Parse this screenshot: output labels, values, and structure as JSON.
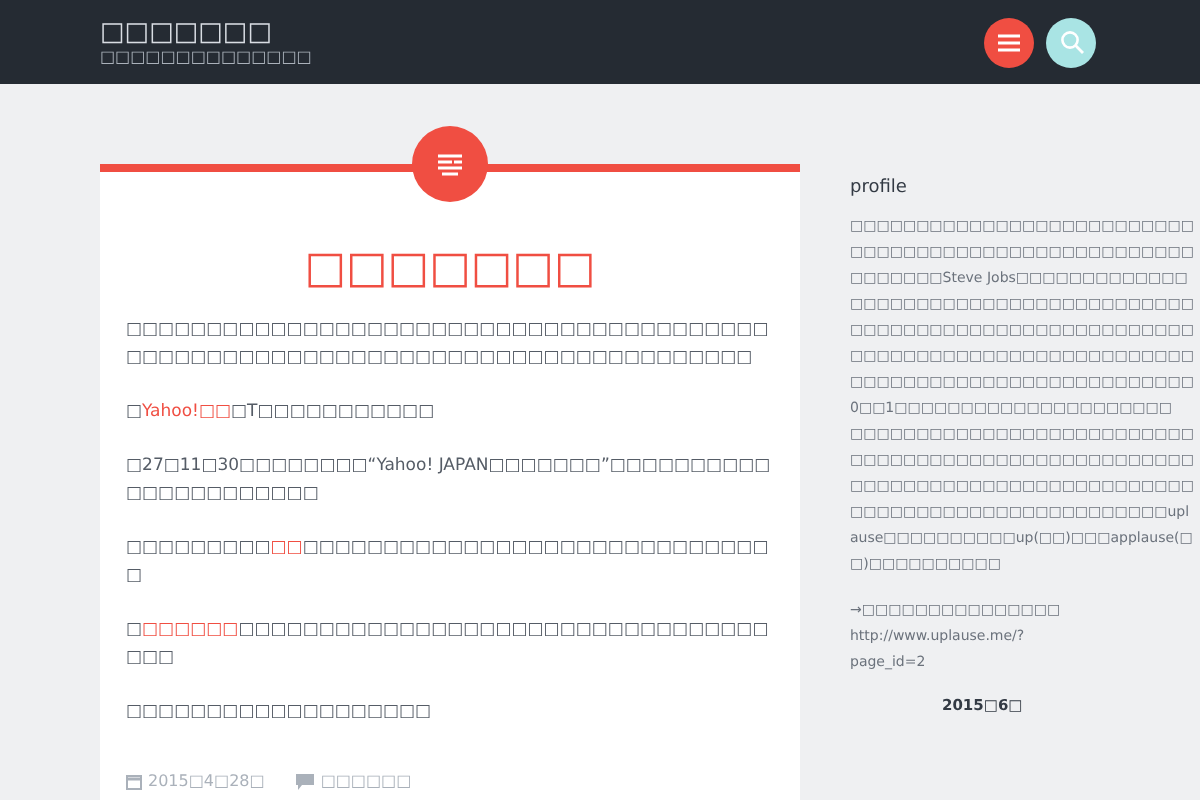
{
  "header": {
    "site_title": "□□□□□□□",
    "tagline": "□□□□□□□□□□□□□□"
  },
  "post": {
    "title": "□□□□□□□",
    "paragraphs": [
      [
        {
          "text": "□□□□□□□□□□□□□□□□□□□□□□□□□□□□□□□□□□□□□□□□□□□□□□□□□□□□□□□□□□□□□□□□□□□□□□□□□□□□□□□",
          "link": false
        }
      ],
      [
        {
          "text": "□",
          "link": false
        },
        {
          "text": "Yahoo!□□",
          "link": true
        },
        {
          "text": "□T□□□□□□□□□□□",
          "link": false
        }
      ],
      [
        {
          "text": "□27□11□30□□□□□□□□“Yahoo! JAPAN□□□□□□□”□□□□□□□□□□□□□□□□□□□□□□",
          "link": false
        }
      ],
      [
        {
          "text": "□□□□□□□□□",
          "link": false
        },
        {
          "text": "□□",
          "link": true
        },
        {
          "text": "□□□□□□□□□□□□□□□□□□□□□□□□□□□□□□",
          "link": false
        }
      ],
      [
        {
          "text": "□",
          "link": false
        },
        {
          "text": "□□□□□□",
          "link": true
        },
        {
          "text": "□□□□□□□□□□□□□□□□□□□□□□□□□□□□□□□□□□□□",
          "link": false
        }
      ],
      [
        {
          "text": "□□□□□□□□□□□□□□□□□□□",
          "link": false
        }
      ]
    ],
    "date": "2015□4□28□",
    "comments": "□□□□□□"
  },
  "sidebar": {
    "heading": "profile",
    "paragraphs": [
      "□□□□□□□□□□□□□□□□□□□□□□□□□□□□□□□□□□□□□□□□□□□□□□□□□□□□□□□□□□□Steve Jobs□□□□□□□□□□□□□□□□□□□□□□□□□□□□□□□□□□□□□□□□□□□□□□□□□□□□□□□□□□□□□□□□□□□□□□□□□□□□□□□□□□□□□□□□□□□□□□□□□□□□□□□□□□□□□□□□□□□□□0□□1□□□□□□□□□□□□□□□□□□□□□",
      "□□□□□□□□□□□□□□□□□□□□□□□□□□□□□□□□□□□□□□□□□□□□□□□□□□□□□□□□□□□□□□□□□□□□□□□□□□□□□□□□□□□□□□□□□□□□□□□□□□□□□□uplause□□□□□□□□□□up(□□)□□□applause(□□)□□□□□□□□□□"
    ],
    "arrow_text": "→□□□□□□□□□□□□□□□",
    "link": "http://www.uplause.me/?page_id=2",
    "calendar_caption": "2015□6□"
  }
}
